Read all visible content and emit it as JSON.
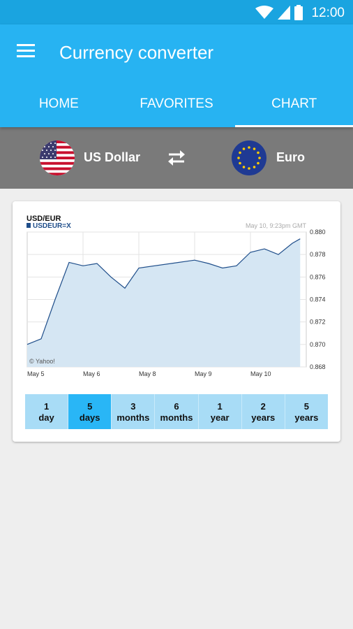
{
  "status_bar": {
    "time": "12:00"
  },
  "app_bar": {
    "title": "Currency converter"
  },
  "tabs": [
    {
      "label": "HOME",
      "active": false
    },
    {
      "label": "FAVORITES",
      "active": false
    },
    {
      "label": "CHART",
      "active": true
    }
  ],
  "currency_pair": {
    "from": {
      "name": "US Dollar",
      "flag": "us-flag"
    },
    "to": {
      "name": "Euro",
      "flag": "eu-flag"
    },
    "swap_icon": "swap-arrows-icon"
  },
  "chart": {
    "title": "USD/EUR",
    "legend": "USDEUR=X",
    "timestamp": "May 10, 9:23pm GMT",
    "credit": "© Yahoo!",
    "colors": {
      "line": "#1f4e8a",
      "fill": "#d5e6f3",
      "grid": "#e3e3e3"
    }
  },
  "chart_data": {
    "type": "area",
    "title": "USD/EUR",
    "series": [
      {
        "name": "USDEUR=X",
        "x": [
          "May 5 00:00",
          "May 5 06:00",
          "May 5 12:00",
          "May 5 18:00",
          "May 6 00:00",
          "May 6 06:00",
          "May 6 12:00",
          "May 6 18:00",
          "May 7 00:00",
          "May 9 00:00",
          "May 9 06:00",
          "May 9 12:00",
          "May 9 18:00",
          "May 10 00:00",
          "May 10 06:00",
          "May 10 12:00",
          "May 10 18:00",
          "May 10 21:23"
        ],
        "y": [
          0.87,
          0.8705,
          0.874,
          0.8773,
          0.877,
          0.8772,
          0.876,
          0.875,
          0.8768,
          0.8775,
          0.8772,
          0.8768,
          0.877,
          0.8782,
          0.8785,
          0.878,
          0.879,
          0.8794
        ]
      }
    ],
    "x_tick_labels": [
      "May 5",
      "May 6",
      "May 8",
      "May 9",
      "May 10"
    ],
    "y_tick_labels": [
      "0.880",
      "0.878",
      "0.876",
      "0.874",
      "0.872",
      "0.870",
      "0.868"
    ],
    "ylim": [
      0.868,
      0.88
    ],
    "grid": true
  },
  "ranges": [
    {
      "value": "1",
      "unit": "day",
      "active": false
    },
    {
      "value": "5",
      "unit": "days",
      "active": true
    },
    {
      "value": "3",
      "unit": "months",
      "active": false
    },
    {
      "value": "6",
      "unit": "months",
      "active": false
    },
    {
      "value": "1",
      "unit": "year",
      "active": false
    },
    {
      "value": "2",
      "unit": "years",
      "active": false
    },
    {
      "value": "5",
      "unit": "years",
      "active": false
    }
  ]
}
